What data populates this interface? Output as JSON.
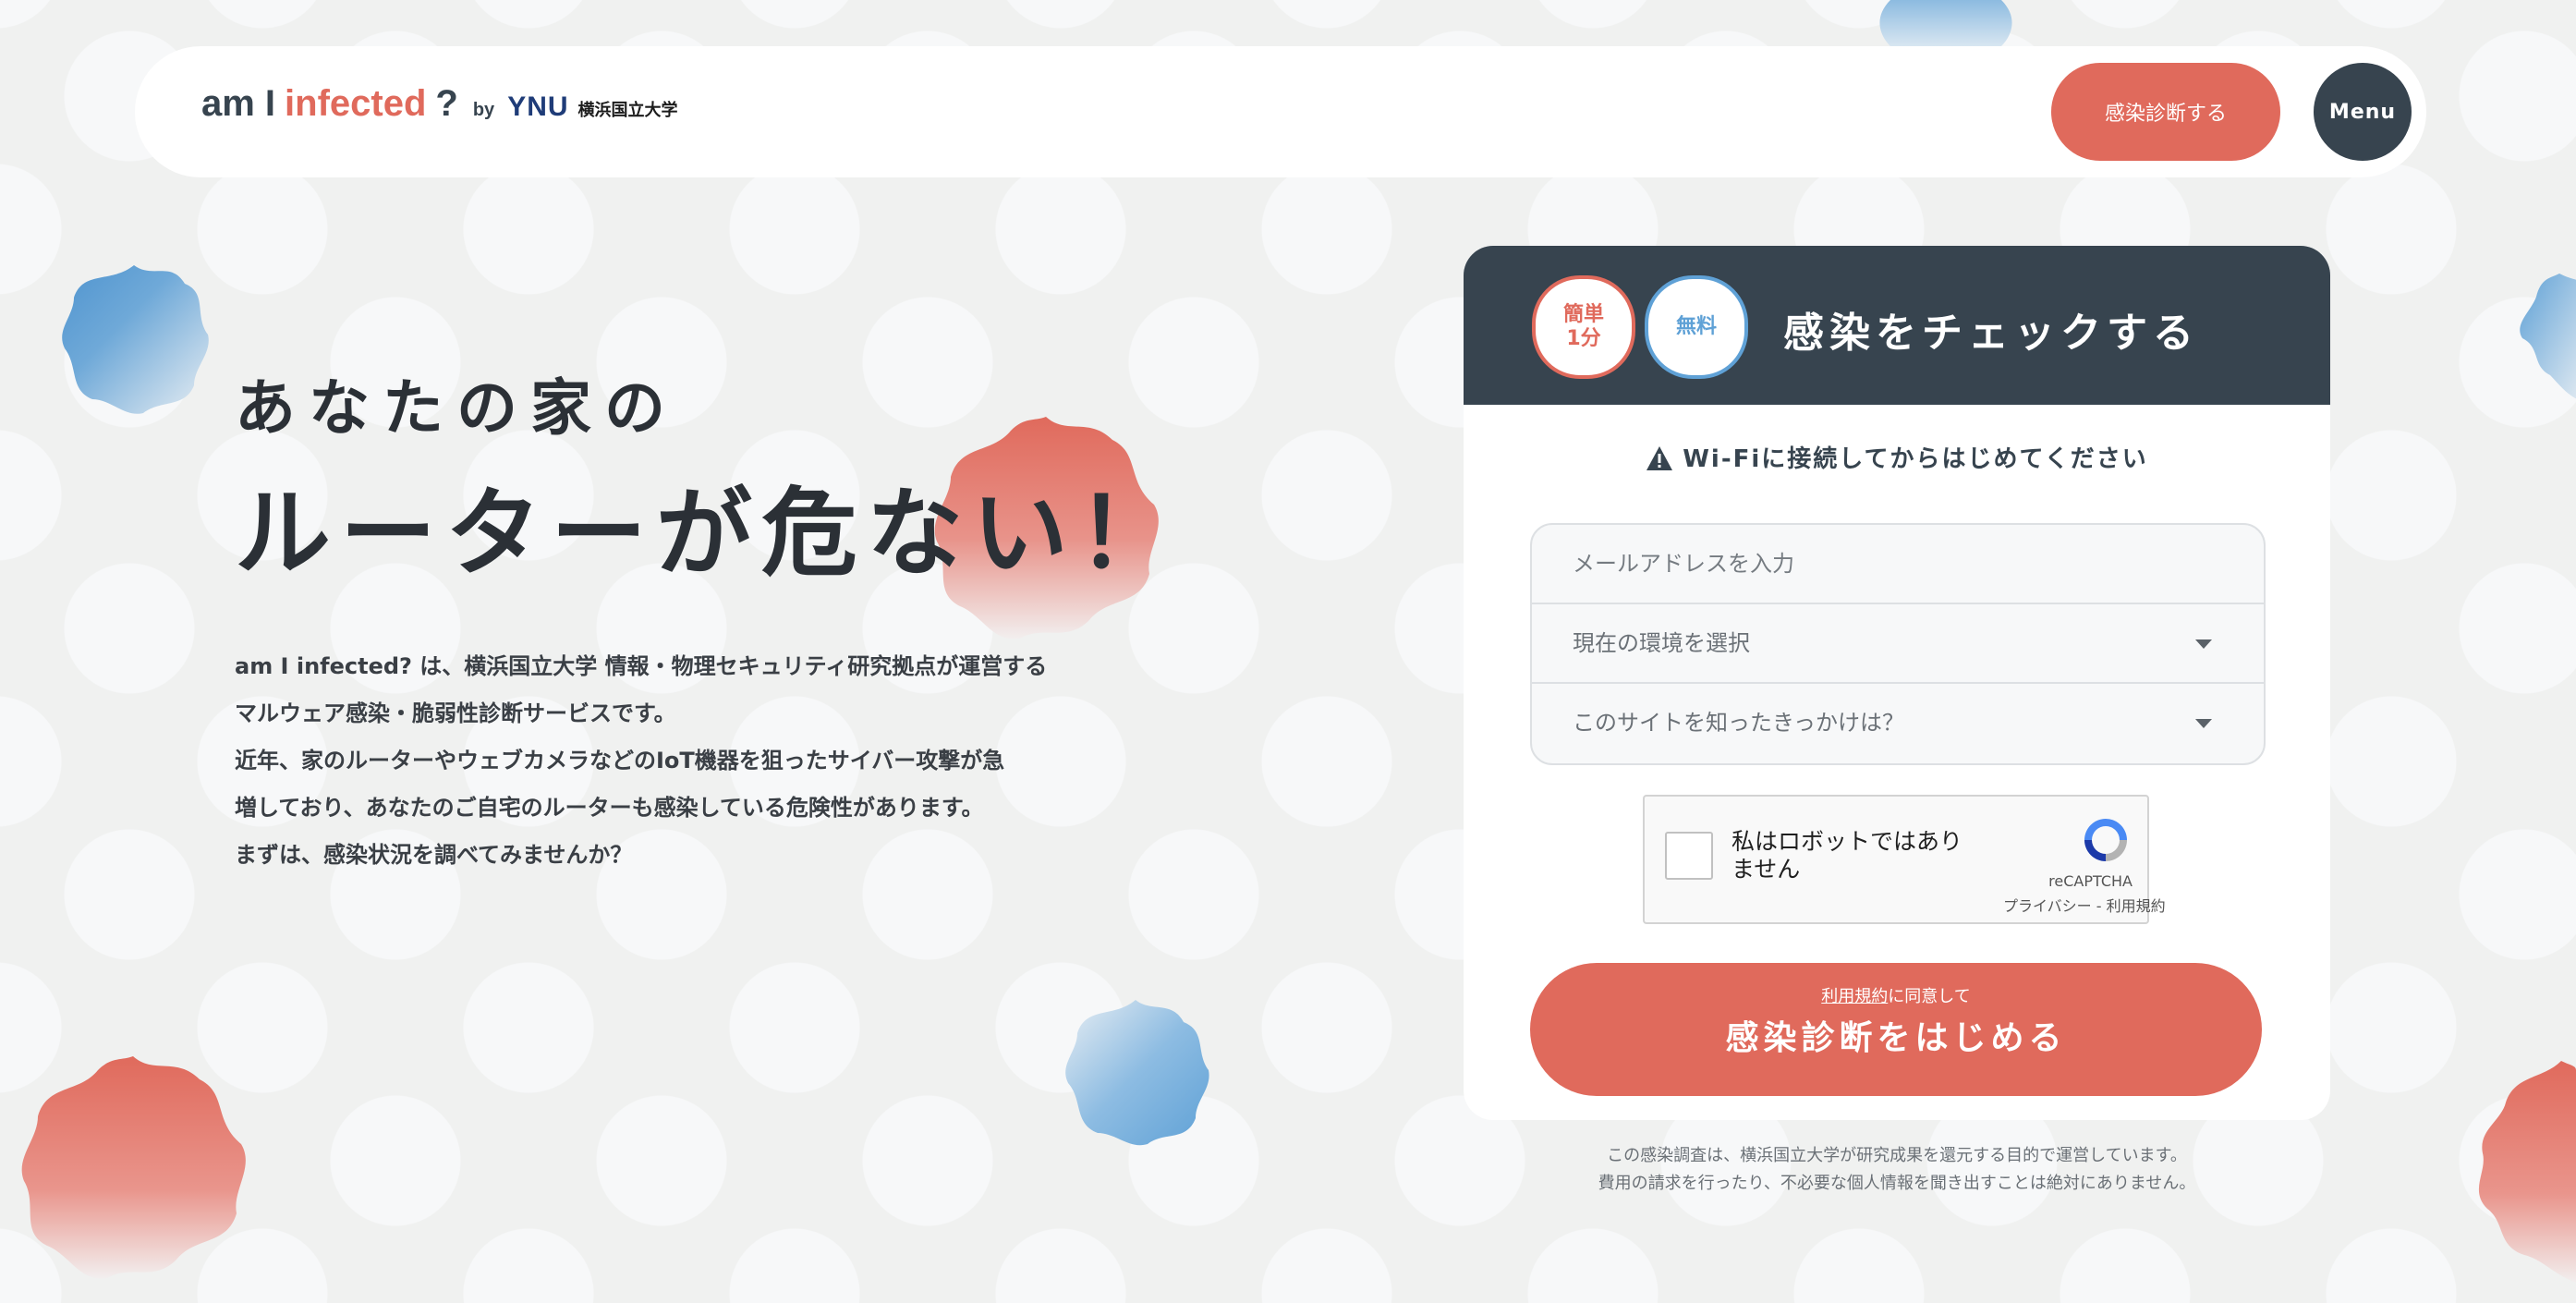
{
  "colors": {
    "accent": "#e06a5c",
    "dark": "#37444f",
    "blue": "#5fa1d6",
    "background": "#f0f1f0"
  },
  "header": {
    "logo": {
      "am": "am I",
      "infected": "infected",
      "q": "?",
      "by": "by",
      "ynu": "YNU",
      "university": "横浜国立大学"
    },
    "cta_label": "感染診断する",
    "menu_label": "Menu"
  },
  "hero": {
    "line1": "あなたの家の",
    "line2": "ルーターが危ない！",
    "description": [
      "am I infected? は、横浜国立大学 情報・物理セキュリティ研究拠点が運営する",
      "マルウェア感染・脆弱性診断サービスです。",
      "近年、家のルーターやウェブカメラなどのIoT機器を狙ったサイバー攻撃が急",
      "増しており、あなたのご自宅のルーターも感染している危険性があります。",
      "まずは、感染状況を調べてみませんか？"
    ]
  },
  "card": {
    "badge_easy": [
      "簡単",
      "1分"
    ],
    "badge_free": "無料",
    "title": "感染をチェックする",
    "notice": "Wi-Fiに接続してからはじめてください",
    "form": {
      "email_placeholder": "メールアドレスを入力",
      "environment_select": "現在の環境を選択",
      "source_select": "このサイトを知ったきっかけは？"
    },
    "captcha": {
      "label": "私はロボットではありません",
      "brand": "reCAPTCHA",
      "links": "プライバシー - 利用規約"
    },
    "start": {
      "terms_link": "利用規約",
      "terms_suffix": "に同意して",
      "label": "感染診断をはじめる"
    }
  },
  "footer": {
    "line1": "この感染調査は、横浜国立大学が研究成果を還元する目的で運営しています。",
    "line2": "費用の請求を行ったり、不必要な個人情報を聞き出すことは絶対にありません。"
  }
}
